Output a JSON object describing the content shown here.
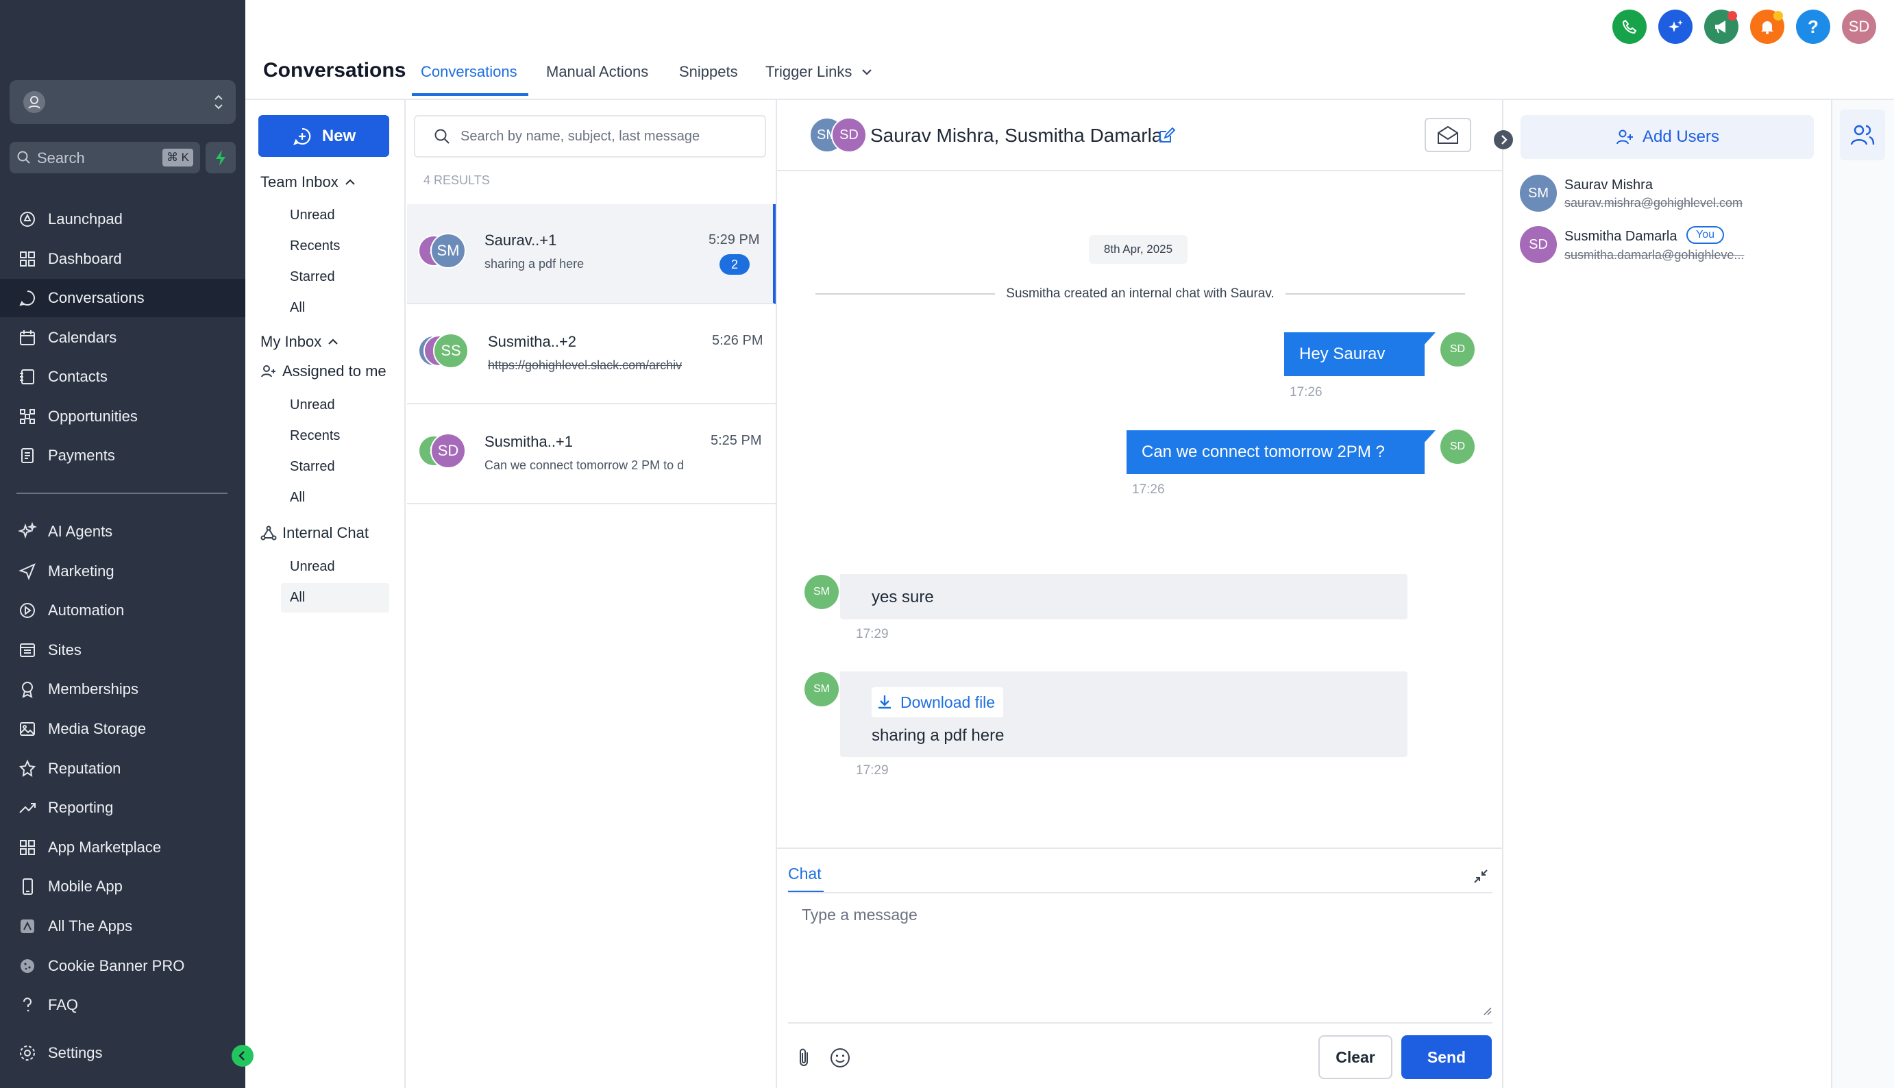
{
  "sidebar": {
    "search_placeholder": "Search",
    "search_shortcut": "⌘ K",
    "nav_items": [
      {
        "label": "Launchpad",
        "icon": "rocket-icon"
      },
      {
        "label": "Dashboard",
        "icon": "grid-icon"
      },
      {
        "label": "Conversations",
        "icon": "chat-icon",
        "active": true
      },
      {
        "label": "Calendars",
        "icon": "calendar-icon"
      },
      {
        "label": "Contacts",
        "icon": "contacts-icon"
      },
      {
        "label": "Opportunities",
        "icon": "opportunities-icon"
      },
      {
        "label": "Payments",
        "icon": "payments-icon"
      }
    ],
    "nav_items_2": [
      {
        "label": "AI Agents",
        "icon": "sparkle-icon"
      },
      {
        "label": "Marketing",
        "icon": "send-icon"
      },
      {
        "label": "Automation",
        "icon": "play-icon"
      },
      {
        "label": "Sites",
        "icon": "sites-icon"
      },
      {
        "label": "Memberships",
        "icon": "award-icon"
      },
      {
        "label": "Media Storage",
        "icon": "image-icon"
      },
      {
        "label": "Reputation",
        "icon": "star-icon"
      },
      {
        "label": "Reporting",
        "icon": "trend-icon"
      },
      {
        "label": "App Marketplace",
        "icon": "apps-icon"
      },
      {
        "label": "Mobile App",
        "icon": "phone-icon"
      },
      {
        "label": "All The Apps",
        "icon": "app-icon"
      },
      {
        "label": "Cookie Banner PRO",
        "icon": "cookie-icon"
      },
      {
        "label": "FAQ",
        "icon": "question-icon"
      }
    ],
    "settings_label": "Settings"
  },
  "header": {
    "title": "Conversations",
    "tabs": [
      "Conversations",
      "Manual Actions",
      "Snippets",
      "Trigger Links"
    ],
    "active_tab": "Conversations",
    "user_initials": "SD"
  },
  "inbox": {
    "new_label": "New",
    "team_inbox_label": "Team Inbox",
    "team_items": [
      "Unread",
      "Recents",
      "Starred",
      "All"
    ],
    "my_inbox_label": "My Inbox",
    "assigned_label": "Assigned to me",
    "my_items": [
      "Unread",
      "Recents",
      "Starred",
      "All"
    ],
    "internal_chat_label": "Internal Chat",
    "internal_items": [
      "Unread",
      "All"
    ]
  },
  "conversation_list": {
    "search_placeholder": "Search by name, subject, last message",
    "results_label": "4 RESULTS",
    "items": [
      {
        "name": "Saurav..+1",
        "preview": "sharing a pdf here",
        "time": "5:29 PM",
        "unread": "2",
        "avatar_front": "SM",
        "avatar_back": "S"
      },
      {
        "name": "Susmitha..+2",
        "preview": "https://gohighlevel.slack.com/archiv",
        "time": "5:26 PM",
        "avatar_front": "SS"
      },
      {
        "name": "Susmitha..+1",
        "preview": "Can we connect tomorrow 2 PM to d",
        "time": "5:25 PM",
        "avatar_front": "SD",
        "avatar_back": "S"
      }
    ]
  },
  "chat": {
    "header_avatars": [
      "SM",
      "SD"
    ],
    "title": "Saurav Mishra, Susmitha Damarla",
    "date_label": "8th Apr, 2025",
    "system_message": "Susmitha created an internal chat with Saurav.",
    "messages": [
      {
        "text": "Hey Saurav",
        "time": "17:26",
        "avatar": "SD",
        "direction": "out"
      },
      {
        "text": "Can we connect tomorrow 2PM ?",
        "time": "17:26",
        "avatar": "SD",
        "direction": "out"
      },
      {
        "text": "yes sure",
        "time": "17:29",
        "avatar": "SM",
        "direction": "in"
      },
      {
        "text": "sharing a pdf here",
        "time": "17:29",
        "avatar": "SM",
        "direction": "in",
        "attachment_label": "Download file"
      }
    ],
    "composer": {
      "tab_label": "Chat",
      "placeholder": "Type a message",
      "clear_label": "Clear",
      "send_label": "Send"
    }
  },
  "right_panel": {
    "add_users_label": "Add Users",
    "users": [
      {
        "initials": "SM",
        "name": "Saurav Mishra",
        "email": "saurav.mishra@gohighlevel.com"
      },
      {
        "initials": "SD",
        "name": "Susmitha Damarla",
        "email": "susmitha.damarla@gohighleve...",
        "you_label": "You"
      }
    ]
  },
  "colors": {
    "sidebar_bg": "#2c3444",
    "accent": "#1d5fe0",
    "outgoing_bubble": "#1d7ae8",
    "incoming_bubble": "#eef0f4"
  }
}
